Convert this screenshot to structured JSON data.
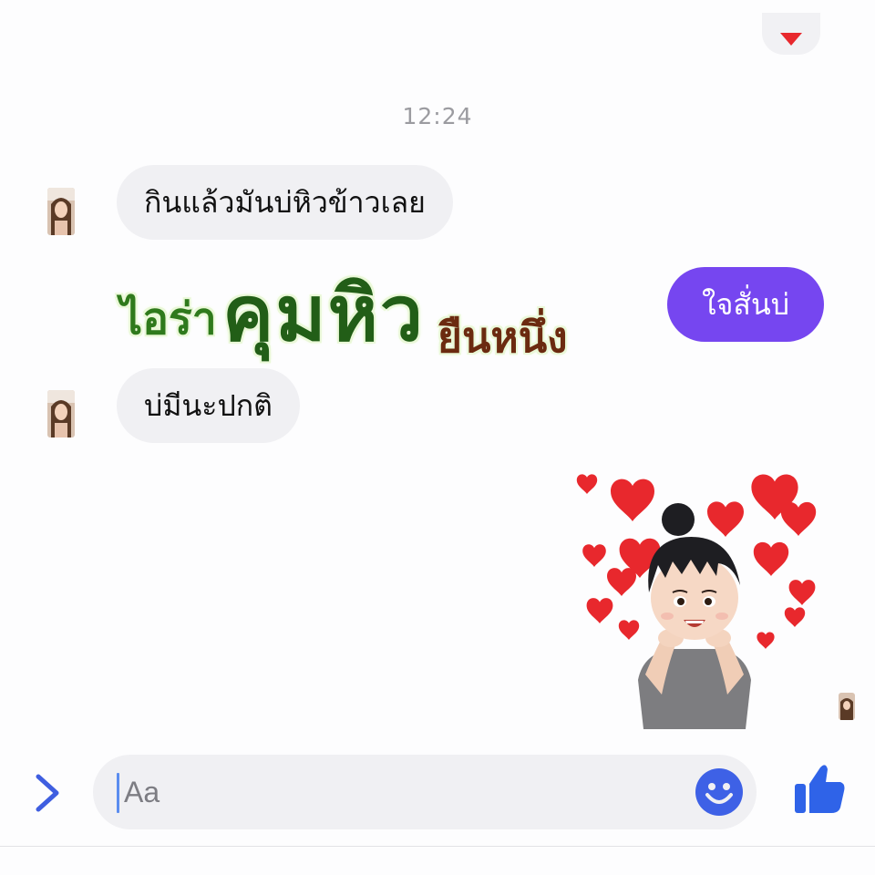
{
  "thread": {
    "timestamp": "12:24",
    "messages": [
      {
        "from": "other",
        "text": "กินแล้วมันบ่หิวข้าวเลย"
      },
      {
        "from": "me",
        "text": "ใจสั่นบ่"
      },
      {
        "from": "other",
        "text": "บ่มีนะปกติ"
      }
    ],
    "overlay_caption": {
      "part1": "ไอร่า",
      "part2": "คุมหิว",
      "part3": "ยืนหนึ่ง"
    },
    "sticker": "avatar-hearts-sticker"
  },
  "composer": {
    "placeholder": "Aa",
    "icons": [
      "chevron-right-icon",
      "smiley-icon",
      "thumbs-up-icon"
    ]
  },
  "colors": {
    "outgoing_bubble": "#7646f0",
    "incoming_bubble": "#f0f0f3",
    "accent_blue": "#2f63e8",
    "caption_green": "#225e17",
    "caption_brown": "#6b2a10",
    "heart_red": "#e8282d"
  }
}
